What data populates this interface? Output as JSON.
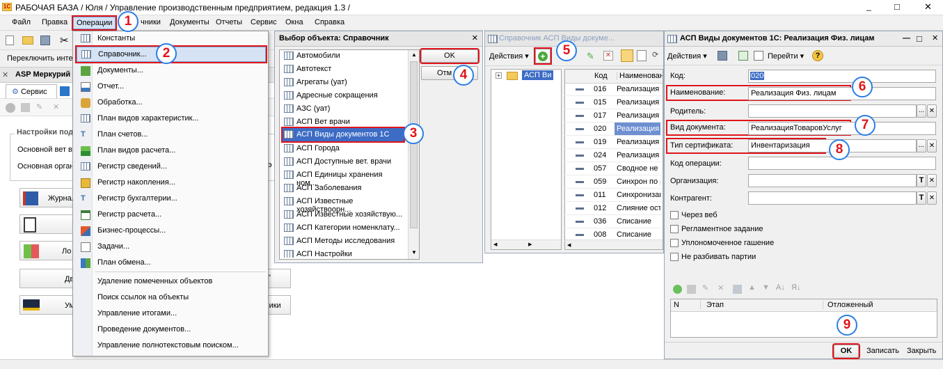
{
  "app": {
    "title": "РАБОЧАЯ БАЗА / Юля / Управление производственным предприятием, редакция 1.3 /",
    "window_buttons": [
      "_",
      "□",
      "✕"
    ]
  },
  "menubar": {
    "items": [
      "Файл",
      "Правка",
      "Операции",
      "Справочники",
      "Документы",
      "Отчеты",
      "Сервис",
      "Окна",
      "Справка"
    ],
    "visible": [
      "Файл",
      "Правка",
      "Операции",
      "чники",
      "Документы",
      "Отчеты",
      "Сервис",
      "Окна",
      "Справка"
    ]
  },
  "switch_label": "Переключить инте",
  "left_panel": {
    "title": "ASP Меркурий",
    "tab_label": "Сервис",
    "settings_title": "Настройки под",
    "row1": "Основной вет в",
    "row2": "Основная орган",
    "buttons": [
      "Журнал",
      "",
      "Ло",
      "Движе",
      "Ум"
    ],
    "right_stub_1": "\"",
    "right_stub_2": "мики"
  },
  "operations_menu": {
    "items": [
      "Константы",
      "Справочник...",
      "Документы...",
      "Отчет...",
      "Обработка...",
      "План видов характеристик...",
      "План счетов...",
      "План видов расчета...",
      "Регистр сведений...",
      "Регистр накопления...",
      "Регистр бухгалтерии...",
      "Регистр расчета...",
      "Бизнес-процессы...",
      "Задачи...",
      "План обмена...",
      "Удаление помеченных объектов",
      "Поиск ссылок на объекты",
      "Управление итогами...",
      "Проведение документов...",
      "Управление полнотекстовым поиском..."
    ]
  },
  "select_dialog": {
    "title": "Выбор объекта: Справочник",
    "close": "✕",
    "ok_label": "OK",
    "cancel_label": "Отм",
    "items": [
      "Автомобили",
      "Автотекст",
      "Агрегаты (уат)",
      "Адресные сокращения",
      "АЗС (уат)",
      "АСП Вет врачи",
      "АСП Виды документов 1С",
      "АСП Города",
      "АСП Доступные вет. врачи",
      "АСП Единицы хранения ном...",
      "АСП Заболевания",
      "АСП Известные хозяйствоорн...",
      "АСП Известные хозяйствую...",
      "АСП Категории номенклату...",
      "АСП Методы исследования",
      "АСП Настройки"
    ]
  },
  "catalog_window": {
    "title": "Справочник АСП Виды докуме...",
    "actions_label": "Действия",
    "tree_item": "АСП Ви",
    "col_code": "Код",
    "col_name": "Наименован",
    "rows": [
      {
        "code": "016",
        "name": "Реализация"
      },
      {
        "code": "015",
        "name": "Реализация"
      },
      {
        "code": "017",
        "name": "Реализация"
      },
      {
        "code": "020",
        "name": "Реализация"
      },
      {
        "code": "019",
        "name": "Реализация"
      },
      {
        "code": "024",
        "name": "Реализация"
      },
      {
        "code": "057",
        "name": "Сводное не"
      },
      {
        "code": "059",
        "name": "Синхрон по р"
      },
      {
        "code": "011",
        "name": "Синхронизац"
      },
      {
        "code": "012",
        "name": "Слияние ост"
      },
      {
        "code": "036",
        "name": "Списание"
      },
      {
        "code": "008",
        "name": "Списание"
      }
    ]
  },
  "element_form": {
    "title": "АСП Виды документов 1С: Реализация Физ. лицам",
    "actions_label": "Действия",
    "goto_label": "Перейти",
    "help": "?",
    "code_label": "Код:",
    "code_value": "020",
    "name_label": "Наименование:",
    "name_value": "Реализация Физ. лицам",
    "parent_label": "Родитель:",
    "doc_type_label": "Вид документа:",
    "doc_type_value": "РеализацияТоваровУслуг",
    "cert_type_label": "Тип сертификата:",
    "cert_type_value": "Инвентаризация",
    "op_code_label": "Код операции:",
    "org_label": "Организация:",
    "contractor_label": "Контрагент:",
    "checkboxes": [
      "Через веб",
      "Регламентное задание",
      "Уплономоченное гашение",
      "Не разбивать партии"
    ],
    "table_cols": [
      "N",
      "Этап",
      "Отложенный"
    ],
    "ok_label": "OK",
    "save_label": "Записать",
    "close_label": "Закрыть",
    "dots": "...",
    "x": "✕",
    "t": "T"
  },
  "badges": [
    "1",
    "2",
    "3",
    "4",
    "5",
    "6",
    "7",
    "8",
    "9"
  ],
  "colors": {
    "accent": "#e0141a",
    "badge_ring": "#2a7ee6",
    "selection": "#3d6cc5",
    "menu_hover": "#d5e3f5"
  }
}
